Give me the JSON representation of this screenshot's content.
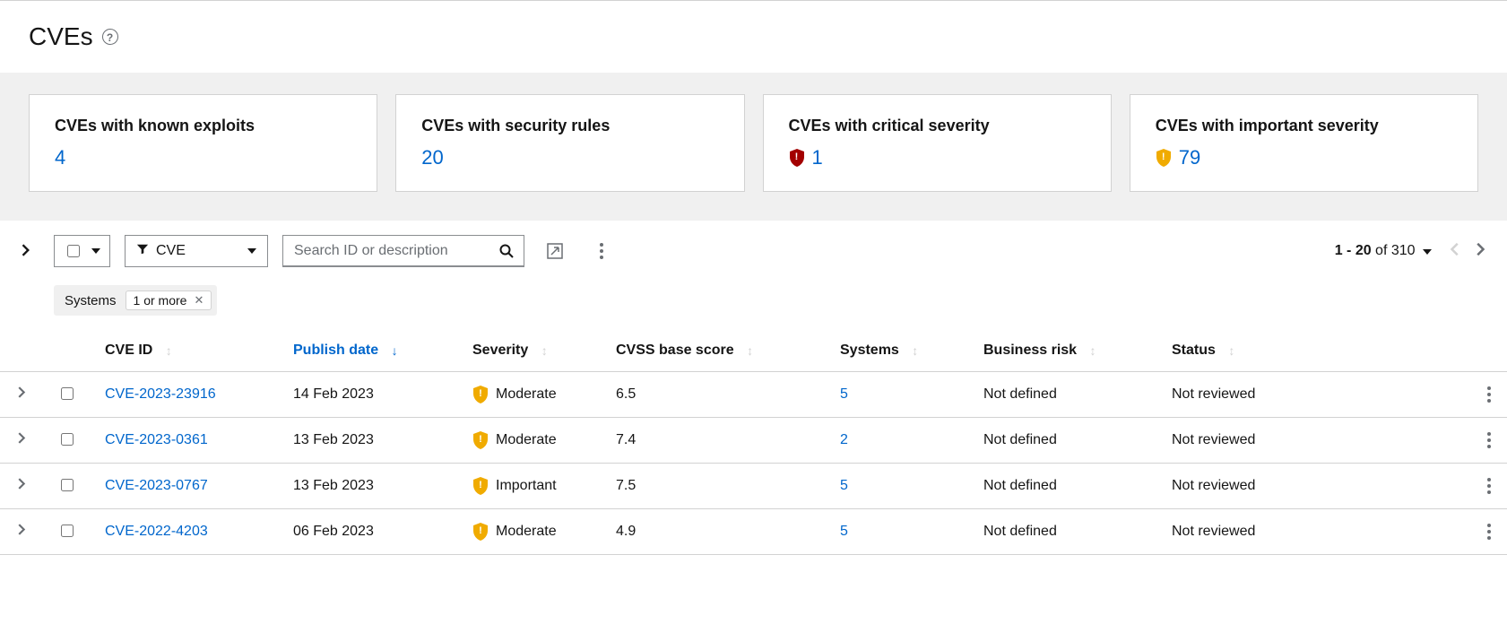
{
  "page_title": "CVEs",
  "cards": [
    {
      "title": "CVEs with known exploits",
      "value": "4",
      "icon": null
    },
    {
      "title": "CVEs with security rules",
      "value": "20",
      "icon": null
    },
    {
      "title": "CVEs with critical severity",
      "value": "1",
      "icon": "critical"
    },
    {
      "title": "CVEs with important severity",
      "value": "79",
      "icon": "important"
    }
  ],
  "toolbar": {
    "filter_type": "CVE",
    "search_placeholder": "Search ID or description"
  },
  "chips": {
    "group_label": "Systems",
    "items": [
      "1 or more"
    ]
  },
  "pagination": {
    "range_start": "1",
    "range_end": "20",
    "total": "310"
  },
  "columns": {
    "cve_id": "CVE ID",
    "publish_date": "Publish date",
    "severity": "Severity",
    "cvss": "CVSS base score",
    "systems": "Systems",
    "business_risk": "Business risk",
    "status": "Status"
  },
  "rows": [
    {
      "cve": "CVE-2023-23916",
      "date": "14 Feb 2023",
      "severity": "Moderate",
      "sev_level": "moderate",
      "cvss": "6.5",
      "systems": "5",
      "risk": "Not defined",
      "status": "Not reviewed"
    },
    {
      "cve": "CVE-2023-0361",
      "date": "13 Feb 2023",
      "severity": "Moderate",
      "sev_level": "moderate",
      "cvss": "7.4",
      "systems": "2",
      "risk": "Not defined",
      "status": "Not reviewed"
    },
    {
      "cve": "CVE-2023-0767",
      "date": "13 Feb 2023",
      "severity": "Important",
      "sev_level": "important",
      "cvss": "7.5",
      "systems": "5",
      "risk": "Not defined",
      "status": "Not reviewed"
    },
    {
      "cve": "CVE-2022-4203",
      "date": "06 Feb 2023",
      "severity": "Moderate",
      "sev_level": "moderate",
      "cvss": "4.9",
      "systems": "5",
      "risk": "Not defined",
      "status": "Not reviewed"
    }
  ]
}
